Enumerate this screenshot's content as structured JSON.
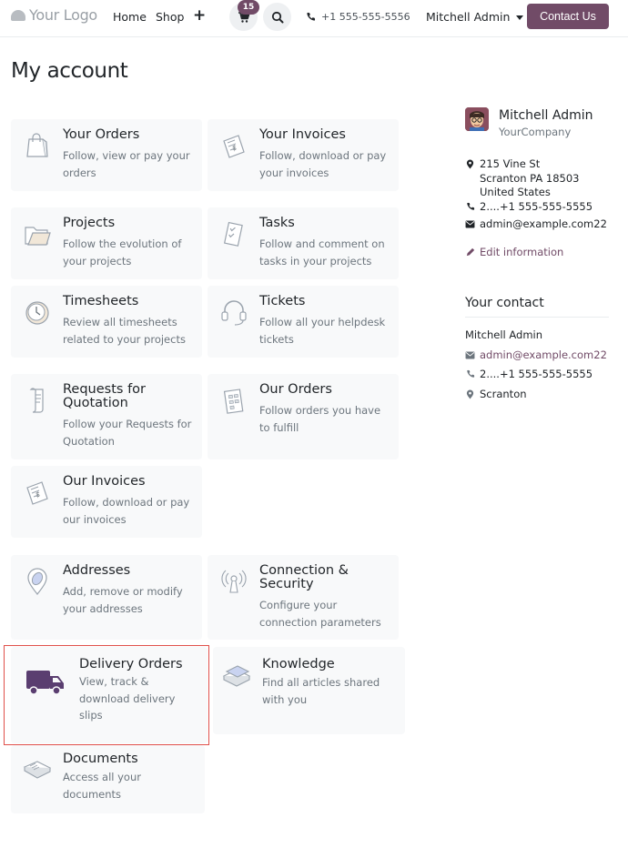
{
  "header": {
    "logo_text": "Your Logo",
    "nav": [
      "Home",
      "Shop"
    ],
    "plus": "+",
    "cart_count": "15",
    "phone": "+1 555-555-5556",
    "user_name": "Mitchell Admin",
    "contact_button": "Contact Us",
    "accent_color": "#714b67"
  },
  "page_title": "My account",
  "cards": [
    {
      "title": "Your Orders",
      "desc": "Follow, view or pay your orders",
      "icon": "shopping-bag-icon"
    },
    {
      "title": "Your Invoices",
      "desc": "Follow, download or pay your invoices",
      "icon": "invoice-icon"
    },
    {
      "title": "Projects",
      "desc": "Follow the evolution of your projects",
      "icon": "folder-icon"
    },
    {
      "title": "Tasks",
      "desc": "Follow and comment on tasks in your projects",
      "icon": "tasks-checklist-icon"
    },
    {
      "title": "Timesheets",
      "desc": "Review all timesheets related to your projects",
      "icon": "clock-icon"
    },
    {
      "title": "Tickets",
      "desc": "Follow all your helpdesk tickets",
      "icon": "headset-icon"
    },
    {
      "title": "Requests for Quotation",
      "desc": "Follow your Requests for Quotation",
      "icon": "scroll-icon"
    },
    {
      "title": "Our Orders",
      "desc": "Follow orders you have to fulfill",
      "icon": "order-form-icon"
    },
    {
      "title": "Our Invoices",
      "desc": "Follow, download or pay our invoices",
      "icon": "invoice-icon"
    },
    {
      "title": "Addresses",
      "desc": "Add, remove or modify your addresses",
      "icon": "map-pin-icon"
    },
    {
      "title": "Connection & Security",
      "desc": "Configure your connection parameters",
      "icon": "security-antenna-icon"
    },
    {
      "title": "Delivery Orders",
      "desc": "View, track & download delivery slips",
      "icon": "delivery-truck-icon"
    },
    {
      "title": "Knowledge",
      "desc": "Find all articles shared with you",
      "icon": "books-icon"
    },
    {
      "title": "Documents",
      "desc": "Access all your documents",
      "icon": "documents-stack-icon"
    }
  ],
  "profile": {
    "name": "Mitchell Admin",
    "company": "YourCompany",
    "address_line1": "215 Vine St",
    "address_line2": "Scranton PA 18503",
    "address_line3": "United States",
    "phone": "2....+1 555-555-5555",
    "email": "admin@example.com22",
    "edit_label": "Edit information"
  },
  "contact": {
    "heading": "Your contact",
    "name": "Mitchell Admin",
    "email": "admin@example.com22",
    "phone": "2....+1 555-555-5555",
    "city": "Scranton"
  }
}
